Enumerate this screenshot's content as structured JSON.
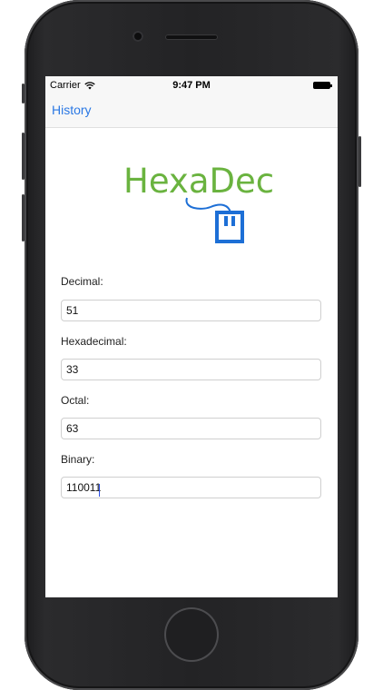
{
  "status_bar": {
    "carrier": "Carrier",
    "time": "9:47 PM"
  },
  "nav": {
    "back_label": "History"
  },
  "logo": {
    "text": "HexaDec",
    "brand_green": "#6ab33f",
    "brand_blue": "#1d6fd6"
  },
  "fields": [
    {
      "label": "Decimal:",
      "value": "51"
    },
    {
      "label": "Hexadecimal:",
      "value": "33"
    },
    {
      "label": "Octal:",
      "value": "63"
    },
    {
      "label": "Binary:",
      "value": "110011"
    }
  ],
  "colors": {
    "accent": "#2b78e4",
    "phone_body": "#232325"
  }
}
